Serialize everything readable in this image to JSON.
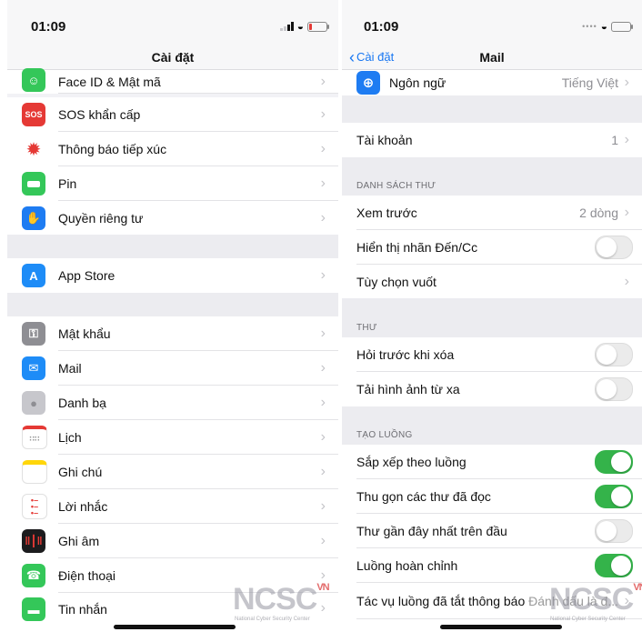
{
  "left": {
    "time": "01:09",
    "nav_title": "Cài đặt",
    "items": [
      {
        "label": "Face ID & Mật mã",
        "icon": "face-id-icon",
        "color": "#34c759"
      },
      {
        "label": "SOS khẩn cấp",
        "icon": "sos-icon",
        "color": "#e53935",
        "icon_text": "SOS"
      },
      {
        "label": "Thông báo tiếp xúc",
        "icon": "exposure-notification-icon",
        "color": "#ffffff"
      },
      {
        "label": "Pin",
        "icon": "battery-icon",
        "color": "#34c759"
      },
      {
        "label": "Quyền riêng tư",
        "icon": "hand-icon",
        "color": "#1e7cf2"
      },
      {
        "label": "App Store",
        "icon": "app-store-icon",
        "color": "#1e8cf7"
      },
      {
        "label": "Mật khẩu",
        "icon": "key-icon",
        "color": "#8e8e93"
      },
      {
        "label": "Mail",
        "icon": "mail-icon",
        "color": "#1e8cf7"
      },
      {
        "label": "Danh bạ",
        "icon": "contacts-icon",
        "color": "#c7c7cc"
      },
      {
        "label": "Lịch",
        "icon": "calendar-icon",
        "color": "#ffffff"
      },
      {
        "label": "Ghi chú",
        "icon": "notes-icon",
        "color": "#ffd60a"
      },
      {
        "label": "Lời nhắc",
        "icon": "reminders-icon",
        "color": "#ffffff"
      },
      {
        "label": "Ghi âm",
        "icon": "voice-memos-icon",
        "color": "#1c1c1e"
      },
      {
        "label": "Điện thoại",
        "icon": "phone-icon",
        "color": "#34c759"
      },
      {
        "label": "Tin nhắn",
        "icon": "messages-icon",
        "color": "#34c759"
      }
    ]
  },
  "right": {
    "time": "01:09",
    "back_label": "Cài đặt",
    "nav_title": "Mail",
    "language": {
      "label": "Ngôn ngữ",
      "value": "Tiếng Việt"
    },
    "accounts": {
      "label": "Tài khoản",
      "value": "1"
    },
    "section_list": "DANH SÁCH THƯ",
    "preview": {
      "label": "Xem trước",
      "value": "2 dòng"
    },
    "show_to_cc": {
      "label": "Hiển thị nhãn Đến/Cc",
      "on": false
    },
    "swipe_options": {
      "label": "Tùy chọn vuốt"
    },
    "section_mail": "THƯ",
    "ask_before_delete": {
      "label": "Hỏi trước khi xóa",
      "on": false
    },
    "load_remote_images": {
      "label": "Tải hình ảnh từ xa",
      "on": false
    },
    "section_threading": "TẠO LUỒNG",
    "organize_by_thread": {
      "label": "Sắp xếp theo luồng",
      "on": true
    },
    "collapse_read": {
      "label": "Thu gọn các thư đã đọc",
      "on": true
    },
    "most_recent_top": {
      "label": "Thư gần đây nhất trên đầu",
      "on": false
    },
    "complete_threads": {
      "label": "Luồng hoàn chỉnh",
      "on": true
    },
    "muted_thread_action": {
      "label": "Tác vụ luồng đã tắt thông báo",
      "value": "Đánh dấu là đ..."
    }
  },
  "watermark": {
    "text": "NCSC",
    "suffix": "VN",
    "subtitle": "National Cyber Security Center"
  },
  "colors": {
    "accent": "#1877f2",
    "toggle_on": "#34b34a"
  }
}
